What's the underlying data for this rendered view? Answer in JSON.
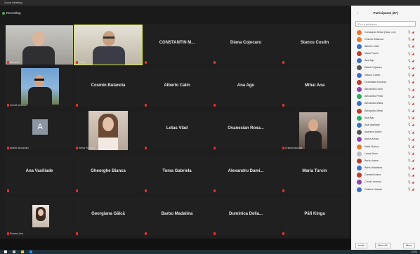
{
  "window": {
    "title": "Zoom Meeting"
  },
  "top": {
    "view_label": "Recording"
  },
  "tiles": [
    {
      "name": "",
      "caption": "Nicoleta",
      "photo": "man-grey-suit"
    },
    {
      "name": "",
      "caption": "Ovidiu",
      "photo": "man-glasses"
    },
    {
      "name": "CONSTANTIN M...",
      "caption": ""
    },
    {
      "name": "Diana Cojocaru",
      "caption": ""
    },
    {
      "name": "Stancu Costin",
      "caption": ""
    },
    {
      "name": "",
      "caption": "Cornel Ionescu",
      "photo": "man-outdoor"
    },
    {
      "name": "Cosmin Bulancia",
      "caption": ""
    },
    {
      "name": "Alberto Calin",
      "caption": ""
    },
    {
      "name": "Ana Agu",
      "caption": ""
    },
    {
      "name": "Mihai Ana",
      "caption": ""
    },
    {
      "name": "",
      "caption": "Andrei Alexandru",
      "photo": "avatar-A"
    },
    {
      "name": "",
      "caption": "Elena Popescu",
      "photo": "woman-long-hair"
    },
    {
      "name": "Lotas Vlad",
      "caption": ""
    },
    {
      "name": "Ovanesian Roxa...",
      "caption": ""
    },
    {
      "name": "",
      "caption": "Cristina Nicolae",
      "photo": "woman-dark"
    },
    {
      "name": "Ana Vasiliade",
      "caption": ""
    },
    {
      "name": "Gheorghe Bianca",
      "caption": ""
    },
    {
      "name": "Toma Gabriela",
      "caption": ""
    },
    {
      "name": "Alexandru Dami...",
      "caption": ""
    },
    {
      "name": "Maria Turcin",
      "caption": ""
    },
    {
      "name": "",
      "caption": "Roxana Ana",
      "photo": "woman-small"
    },
    {
      "name": "Georgiana Gălcă",
      "caption": ""
    },
    {
      "name": "Barbu Madalina",
      "caption": ""
    },
    {
      "name": "Duminica Delia...",
      "caption": ""
    },
    {
      "name": "Păfi Kinga",
      "caption": ""
    }
  ],
  "panel": {
    "title": "Participants (27)",
    "search_placeholder": "Find a participant",
    "participants": [
      {
        "name": "Constantin Mihai (Host, me)",
        "color": "#e8782c"
      },
      {
        "name": "Cosmin Bulancia",
        "color": "#e8782c"
      },
      {
        "name": "Alberto Calin",
        "color": "#3a6fc4"
      },
      {
        "name": "Maria Turcin",
        "color": "#c0392b"
      },
      {
        "name": "Ana Agu",
        "color": "#3a6fc4"
      },
      {
        "name": "Diana Cojocaru",
        "color": "#555555"
      },
      {
        "name": "Stancu Costin",
        "color": "#3a6fc4"
      },
      {
        "name": "Ovanesian Roxana",
        "color": "#c0392b"
      },
      {
        "name": "Alexandru Dami",
        "color": "#8e44ad"
      },
      {
        "name": "Alexandru Petra",
        "color": "#27ae60"
      },
      {
        "name": "Alexandru Maria",
        "color": "#3a6fc4"
      },
      {
        "name": "Alexandru Mihai",
        "color": "#c0392b"
      },
      {
        "name": "Ana Agu",
        "color": "#27ae60"
      },
      {
        "name": "Ana Vasiliade",
        "color": "#3a6fc4"
      },
      {
        "name": "Andreea Dobre",
        "color": "#555555"
      },
      {
        "name": "Andra Alexia",
        "color": "#8e44ad"
      },
      {
        "name": "Anita Viorica",
        "color": "#e8782c"
      },
      {
        "name": "Laura Ilinca",
        "color": "#bdbdbd"
      },
      {
        "name": "Barbu Ioana",
        "color": "#c0392b"
      },
      {
        "name": "Barbu Madalina",
        "color": "#3a6fc4"
      },
      {
        "name": "Camelia Ioana",
        "color": "#c0392b"
      },
      {
        "name": "Cornel Ionescu",
        "color": "#8e44ad"
      },
      {
        "name": "Cristina Nicolae",
        "color": "#3a6fc4"
      }
    ],
    "buttons": {
      "invite": "Invite",
      "mute_all": "Mute All",
      "more": "More"
    }
  },
  "taskbar": {
    "clock": "12:00"
  }
}
